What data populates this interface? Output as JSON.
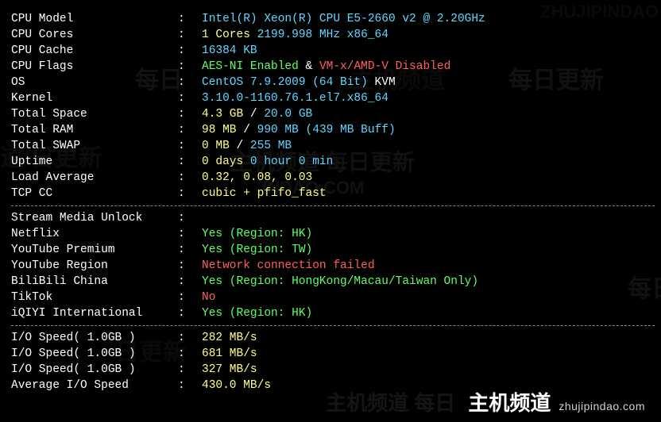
{
  "system": [
    {
      "label": "CPU Model",
      "value": "Intel(R) Xeon(R) CPU E5-2660 v2 @ 2.20GHz",
      "cls": "val-cyan"
    },
    {
      "label": "CPU Cores",
      "value_parts": [
        {
          "text": "1 Cores",
          "cls": "val-yellow"
        },
        {
          "text": " ",
          "cls": "val-white"
        },
        {
          "text": "2199.998 MHz",
          "cls": "val-cyan"
        },
        {
          "text": " ",
          "cls": "val-white"
        },
        {
          "text": "x86_64",
          "cls": "val-cyan"
        }
      ]
    },
    {
      "label": "CPU Cache",
      "value": "16384 KB",
      "cls": "val-cyan"
    },
    {
      "label": "CPU Flags",
      "value_parts": [
        {
          "text": "AES-NI Enabled",
          "cls": "val-green"
        },
        {
          "text": " & ",
          "cls": "val-white"
        },
        {
          "text": "VM-x/AMD-V Disabled",
          "cls": "val-red"
        }
      ]
    },
    {
      "label": "OS",
      "value_parts": [
        {
          "text": "CentOS 7.9.2009 (64 Bit)",
          "cls": "val-cyan"
        },
        {
          "text": " KVM",
          "cls": "val-white"
        }
      ]
    },
    {
      "label": "Kernel",
      "value": "3.10.0-1160.76.1.el7.x86_64",
      "cls": "val-cyan"
    },
    {
      "label": "Total Space",
      "value_parts": [
        {
          "text": "4.3 GB",
          "cls": "val-yellow"
        },
        {
          "text": " / ",
          "cls": "val-white"
        },
        {
          "text": "20.0 GB",
          "cls": "val-cyan"
        }
      ]
    },
    {
      "label": "Total RAM",
      "value_parts": [
        {
          "text": "98 MB",
          "cls": "val-yellow"
        },
        {
          "text": " / ",
          "cls": "val-white"
        },
        {
          "text": "990 MB",
          "cls": "val-cyan"
        },
        {
          "text": " (439 MB Buff)",
          "cls": "val-cyan"
        }
      ]
    },
    {
      "label": "Total SWAP",
      "value_parts": [
        {
          "text": "0 MB",
          "cls": "val-yellow"
        },
        {
          "text": " / ",
          "cls": "val-white"
        },
        {
          "text": "255 MB",
          "cls": "val-cyan"
        }
      ]
    },
    {
      "label": "Uptime",
      "value_parts": [
        {
          "text": "0 days",
          "cls": "val-yellow"
        },
        {
          "text": " ",
          "cls": "val-white"
        },
        {
          "text": "0 hour 0 min",
          "cls": "val-cyan"
        }
      ]
    },
    {
      "label": "Load Average",
      "value": "0.32, 0.08, 0.03",
      "cls": "val-yellow"
    },
    {
      "label": "TCP CC",
      "value": "cubic + pfifo_fast",
      "cls": "val-yellow"
    }
  ],
  "stream_header": "Stream Media Unlock",
  "stream": [
    {
      "label": "Netflix",
      "value": "Yes (Region: HK)",
      "cls": "val-green"
    },
    {
      "label": "YouTube Premium",
      "value": "Yes (Region: TW)",
      "cls": "val-green"
    },
    {
      "label": "YouTube Region",
      "value": "Network connection failed",
      "cls": "val-red"
    },
    {
      "label": "BiliBili China",
      "value": "Yes (Region: HongKong/Macau/Taiwan Only)",
      "cls": "val-green"
    },
    {
      "label": "TikTok",
      "value": "No",
      "cls": "val-red"
    },
    {
      "label": "iQIYI International",
      "value": "Yes (Region: HK)",
      "cls": "val-green"
    }
  ],
  "io": [
    {
      "label": "I/O Speed( 1.0GB )",
      "value": "282 MB/s",
      "cls": "val-yellow"
    },
    {
      "label": "I/O Speed( 1.0GB )",
      "value": "681 MB/s",
      "cls": "val-yellow"
    },
    {
      "label": "I/O Speed( 1.0GB )",
      "value": "327 MB/s",
      "cls": "val-yellow"
    },
    {
      "label": "Average I/O Speed",
      "value": "430.0 MB/s",
      "cls": "val-yellow"
    }
  ],
  "watermarks": {
    "w1": "每日",
    "w2": "主机频道",
    "w3": "每日更新",
    "w4": "道 日更新",
    "w5": "主机频道 每日更新",
    "w6": "INDAO.COM",
    "w7": "每日",
    "w8": "日更新",
    "w9": "ZHUJIPINDAO"
  },
  "banner": {
    "faint": "主机频道 每日",
    "main": "主机频道",
    "sub": "zhujipindao.com"
  }
}
